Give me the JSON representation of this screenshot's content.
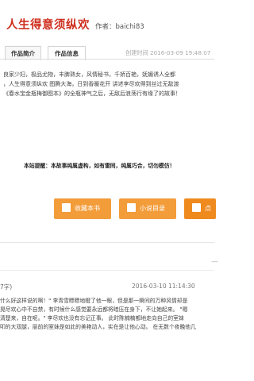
{
  "book": {
    "title": "人生得意须纵欢",
    "author_line": "作者：baichi83",
    "created_line": "创建时间 2016-03-09 19:48:07"
  },
  "tabs": [
    {
      "label": "作品简介"
    },
    {
      "label": "作品信息"
    }
  ],
  "intro": {
    "line1": "良家少妇，极品尤物，丰脾熟女，风情秘书，千娇百艳，妩媚诱人全都",
    "line2": "，人生得意须纵欢 图腾大海，日到香暖花开 讲述李尽欢得到丝过无敌渡",
    "line3": "《春水宝金瓶梅御图本》的全瓶神气之后，无敌后浪荡行有缘了的故事！"
  },
  "notice": "本站提醒：本故事纯属虚构，如有雷同，纯属巧合，切勿模仿！",
  "buttons": {
    "favorite": "收藏本书",
    "toc": "小说目录",
    "more": "点击"
  },
  "separator_dash": "—",
  "comment": {
    "user": "7字)",
    "time": "2016-03-10 11:14:30",
    "lines": [
      "什么好这样说的啊！\" 李青雪瞟瞟地瞪了他一眼，但是那一瞬间的万种风情却是",
      "晃尽欢心中不自禁，有时候什么感觉要永远都将暗压在身下，不让她起来。   \"嗯",
      "清楚来，自在呢。\" 李尽欢也没有忘记正事。        此时陈楠楠都地走向自己的室妹",
      "叩的大双腿，丽前的室妹是如此的美艳动人，实在是让他心动。     在无数个夜晚他几",
      "",
      ""
    ]
  }
}
